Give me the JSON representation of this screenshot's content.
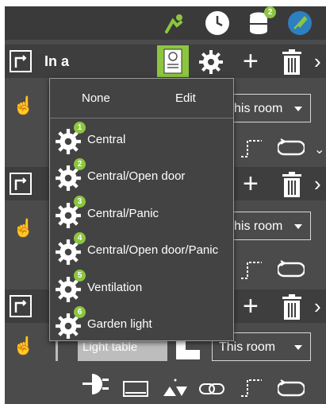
{
  "topbar": {
    "icons": [
      "pointer-icon",
      "clock-icon",
      "database-icon",
      "settings-edit-icon"
    ],
    "database_badge": "2"
  },
  "rows": [
    {
      "title": "In a",
      "room_select": "his room"
    },
    {
      "title": "",
      "room_select": "his room"
    },
    {
      "title": "",
      "room_select": "This room"
    }
  ],
  "popup": {
    "none_label": "None",
    "edit_label": "Edit",
    "items": [
      {
        "badge": "1",
        "label": "Central"
      },
      {
        "badge": "2",
        "label": "Central/Open door"
      },
      {
        "badge": "3",
        "label": "Central/Panic"
      },
      {
        "badge": "4",
        "label": "Central/Open door/Panic"
      },
      {
        "badge": "5",
        "label": "Ventilation"
      },
      {
        "badge": "6",
        "label": "Garden light"
      }
    ]
  },
  "bottom": {
    "light_table_label": "Light table"
  },
  "colors": {
    "accent": "#8cc63f",
    "brand_blue": "#2e7fc0",
    "background": "#4b4b4b"
  }
}
